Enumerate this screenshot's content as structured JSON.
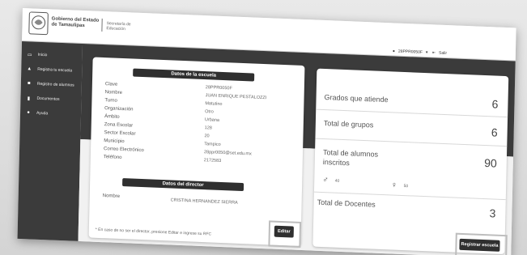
{
  "header": {
    "gov_title": "Gobierno del Estado de Tamaulipas",
    "secretaria": "Secretaría de Educación",
    "user": "28PPR0050F",
    "logout": "Salir",
    "icons": [
      "seal-logo",
      "user-icon",
      "chevron-down-icon",
      "logout-icon"
    ]
  },
  "sidebar": {
    "items": [
      {
        "label": "Inicio",
        "icon": "monitor-icon"
      },
      {
        "label": "Registra tu escuela",
        "icon": "building-icon"
      },
      {
        "label": "Registro de alumnos",
        "icon": "folder-icon"
      },
      {
        "label": "Documentos",
        "icon": "document-icon"
      },
      {
        "label": "Ayuda",
        "icon": "help-icon"
      }
    ]
  },
  "school": {
    "title": "Datos de la escuela",
    "labels": [
      "Clave",
      "Nombre",
      "Turno",
      "Organización",
      "Ámbito",
      "Zona Escolar",
      "Sector Escolar",
      "Municipio",
      "Correo Electrónico",
      "Teléfono"
    ],
    "values": [
      "28PPR0050F",
      "JUAN ENRIQUE PESTALOZZI",
      "Matutino",
      "Otro",
      "Urbana",
      "128",
      "20",
      "Tampico",
      "28ppr0050@set.edu.mx",
      "2172583"
    ]
  },
  "director": {
    "title": "Datos del director",
    "label": "Nombre",
    "value": "CRISTINA HERNANDEZ SIERRA"
  },
  "footnote": "* En caso de no ser el director, presione Editar e ingrese su RFC",
  "edit_button": "Editar",
  "stats": {
    "grados_label": "Grados que atiende",
    "grados_value": "6",
    "grupos_label": "Total de grupos",
    "grupos_value": "6",
    "alumnos_label_1": "Total de alumnos",
    "alumnos_label_2": "inscritos",
    "alumnos_value": "90",
    "male_count": "40",
    "female_count": "50",
    "docentes_label": "Total de Docentes",
    "docentes_value": "3"
  },
  "register_button": "Registrar escuela"
}
